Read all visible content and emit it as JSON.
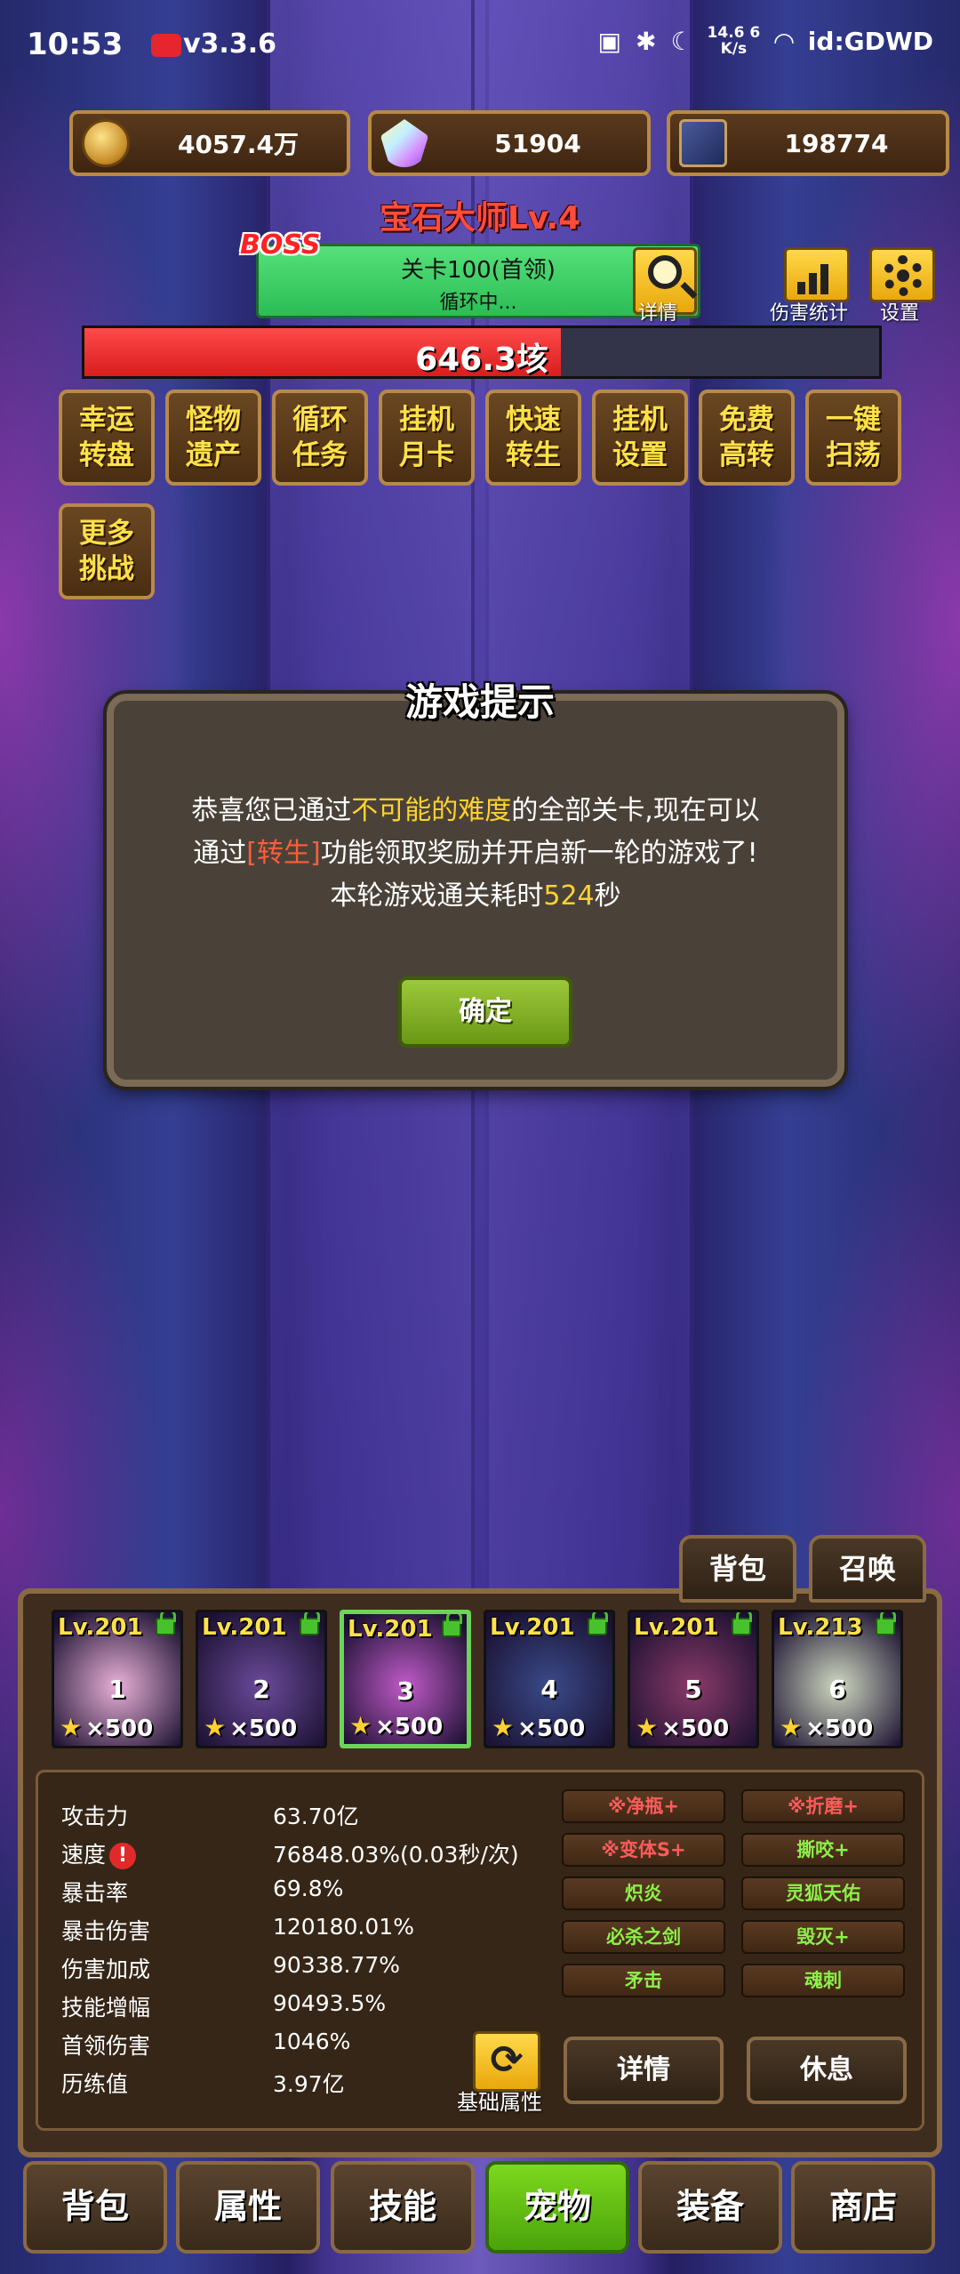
{
  "status_bar": {
    "time": "10:53",
    "version": "v3.3.6",
    "net_speed_top": "14.6 6",
    "net_speed_unit": "K/s",
    "right_text": "id:GDWD"
  },
  "currencies": [
    {
      "icon": "coin-icon",
      "value": "4057.4万"
    },
    {
      "icon": "gem-icon",
      "value": "51904"
    },
    {
      "icon": "card-icon",
      "value": "198774"
    }
  ],
  "master_title": "宝石大师Lv.4",
  "boss_tag": "BOSS",
  "stage": {
    "line1": "关卡100(首领)",
    "line2": "循环中..."
  },
  "detail_label": "详情",
  "damage_stats_label": "伤害统计",
  "settings_label": "设置",
  "boss_hp": {
    "value_text": "646.3垓",
    "fill_fraction": 0.6
  },
  "functions": [
    {
      "label": "幸运转盘"
    },
    {
      "label": "怪物遗产"
    },
    {
      "label": "循环任务"
    },
    {
      "label": "挂机月卡"
    },
    {
      "label": "快速转生"
    },
    {
      "label": "挂机设置"
    },
    {
      "label": "免费高转"
    },
    {
      "label": "一键扫荡"
    },
    {
      "label": "更多挑战"
    }
  ],
  "dialog": {
    "title": "游戏提示",
    "line1_a": "恭喜您已通过",
    "line1_b": "不可能的难度",
    "line1_c": "的全部关卡,现在可以",
    "line2_a": "通过",
    "line2_b": "[转生]",
    "line2_c": "功能领取奖励并开启新一轮的游戏了!",
    "line3_a": "本轮游戏通关耗时",
    "line3_b": "524",
    "line3_c": "秒",
    "ok_label": "确定"
  },
  "bag_top_label": "背包",
  "summon_label": "召唤",
  "pets": [
    {
      "level": "Lv.201",
      "num": "1",
      "count": "×500",
      "color": "#e9b0d8"
    },
    {
      "level": "Lv.201",
      "num": "2",
      "count": "×500",
      "color": "#6a4a9a"
    },
    {
      "level": "Lv.201",
      "num": "3",
      "count": "×500",
      "color": "#c05ac8"
    },
    {
      "level": "Lv.201",
      "num": "4",
      "count": "×500",
      "color": "#3a4a8a"
    },
    {
      "level": "Lv.201",
      "num": "5",
      "count": "×500",
      "color": "#8a3a6a"
    },
    {
      "level": "Lv.213",
      "num": "6",
      "count": "×500",
      "color": "#cfd8c0"
    }
  ],
  "stats": [
    {
      "label": "攻击力",
      "value": "63.70亿"
    },
    {
      "label": "速度",
      "value": "76848.03%(0.03秒/次)"
    },
    {
      "label": "暴击率",
      "value": "69.8%"
    },
    {
      "label": "暴击伤害",
      "value": "120180.01%"
    },
    {
      "label": "伤害加成",
      "value": "90338.77%"
    },
    {
      "label": "技能增幅",
      "value": "90493.5%"
    },
    {
      "label": "首领伤害",
      "value": "1046%"
    },
    {
      "label": "历练值",
      "value": "3.97亿"
    }
  ],
  "skills": [
    {
      "label": "※净瓶+",
      "color": "red"
    },
    {
      "label": "※折磨+",
      "color": "red"
    },
    {
      "label": "※变体S+",
      "color": "red"
    },
    {
      "label": "撕咬+",
      "color": "green"
    },
    {
      "label": "炽炎",
      "color": "green"
    },
    {
      "label": "灵狐天佑",
      "color": "green"
    },
    {
      "label": "必杀之剑",
      "color": "green"
    },
    {
      "label": "毁灭+",
      "color": "green"
    },
    {
      "label": "矛击",
      "color": "green"
    },
    {
      "label": "魂刺",
      "color": "green"
    }
  ],
  "base_attr_label": "基础属性",
  "detail_btn_label": "详情",
  "rest_btn_label": "休息",
  "nav_tabs": [
    {
      "label": "背包"
    },
    {
      "label": "属性"
    },
    {
      "label": "技能"
    },
    {
      "label": "宠物",
      "active": true
    },
    {
      "label": "装备"
    },
    {
      "label": "商店"
    }
  ]
}
